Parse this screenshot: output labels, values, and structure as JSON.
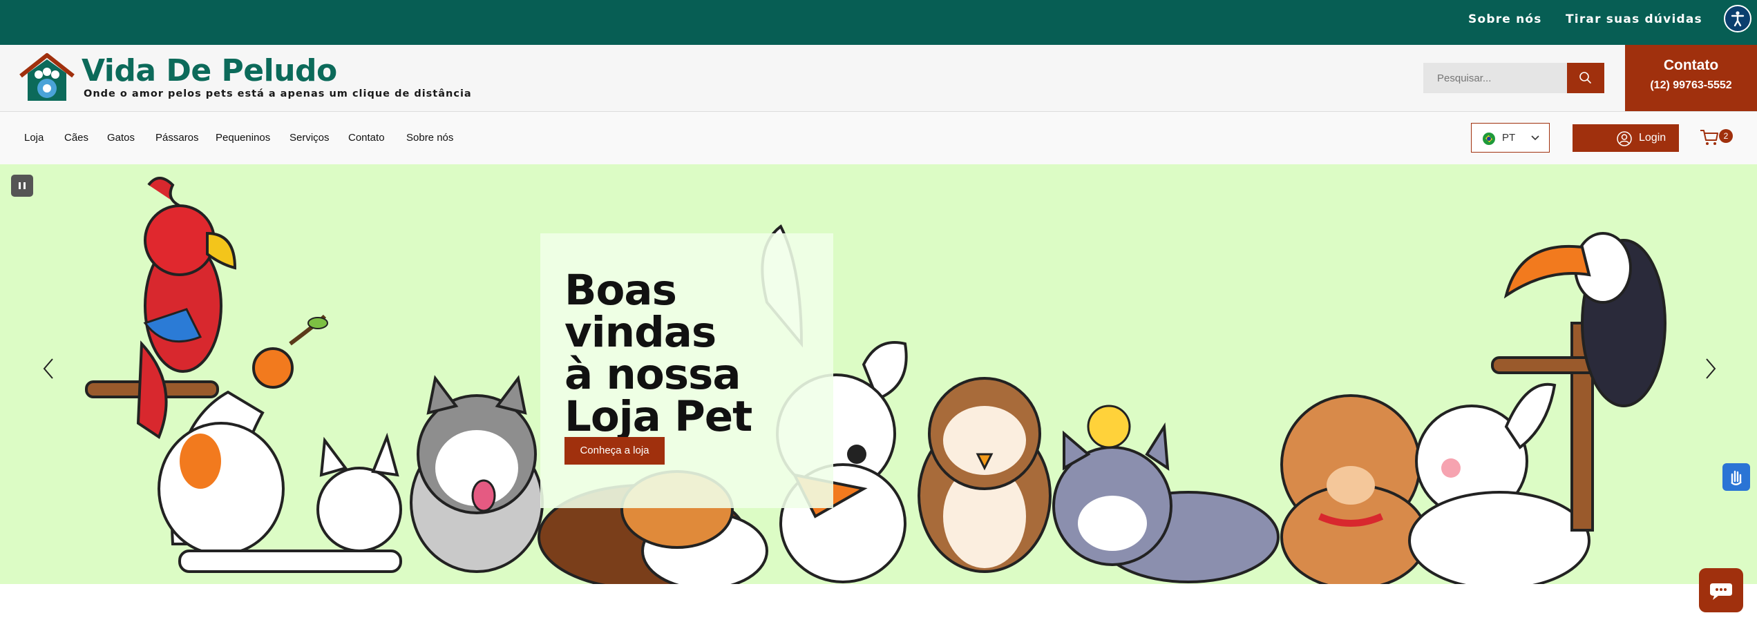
{
  "topbar": {
    "links": [
      "Sobre nós",
      "Tirar suas dúvidas"
    ],
    "accessibility_icon": "accessibility-icon"
  },
  "header": {
    "brand": "Vida De Peludo",
    "tagline": "Onde o amor pelos pets está a apenas um clique de distância",
    "search_placeholder": "Pesquisar...",
    "contact_title": "Contato",
    "contact_phone": "(12) 99763-5552"
  },
  "nav": {
    "items": [
      "Loja",
      "Cães",
      "Gatos",
      "Pássaros",
      "Pequeninos",
      "Serviços",
      "Contato",
      "Sobre nós"
    ],
    "language": "PT",
    "login_label": "Login",
    "cart_count": "2"
  },
  "hero": {
    "headline_line1": "Boas vindas",
    "headline_line2": "à nossa",
    "headline_line3": "Loja Pet",
    "cta": "Conheça a loja"
  },
  "colors": {
    "topbar": "#075e54",
    "brand_text": "#0c6a5a",
    "accent": "#a0300d",
    "hero_bg": "#dcfcc5"
  }
}
